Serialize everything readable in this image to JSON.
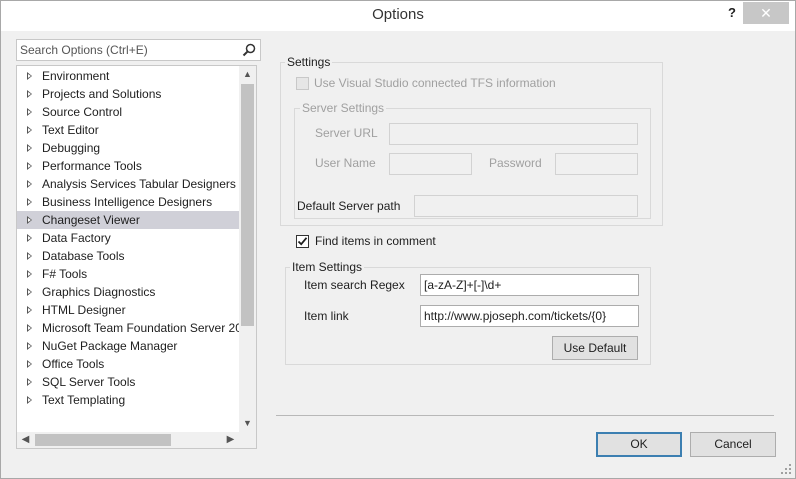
{
  "window": {
    "title": "Options",
    "help_label": "?",
    "close_label": "✕"
  },
  "search": {
    "placeholder": "Search Options (Ctrl+E)"
  },
  "tree": {
    "items": [
      {
        "label": "Environment"
      },
      {
        "label": "Projects and Solutions"
      },
      {
        "label": "Source Control"
      },
      {
        "label": "Text Editor"
      },
      {
        "label": "Debugging"
      },
      {
        "label": "Performance Tools"
      },
      {
        "label": "Analysis Services Tabular Designers"
      },
      {
        "label": "Business Intelligence Designers"
      },
      {
        "label": "Changeset Viewer",
        "selected": true
      },
      {
        "label": "Data Factory"
      },
      {
        "label": "Database Tools"
      },
      {
        "label": "F# Tools"
      },
      {
        "label": "Graphics Diagnostics"
      },
      {
        "label": "HTML Designer"
      },
      {
        "label": "Microsoft Team Foundation Server 20"
      },
      {
        "label": "NuGet Package Manager"
      },
      {
        "label": "Office Tools"
      },
      {
        "label": "SQL Server Tools"
      },
      {
        "label": "Text Templating"
      }
    ]
  },
  "settings": {
    "legend": "Settings",
    "use_tfs_label": "Use Visual Studio connected TFS information",
    "use_tfs_checked": false,
    "server_settings": {
      "legend": "Server Settings",
      "server_url_label": "Server URL",
      "server_url_value": "",
      "user_name_label": "User Name",
      "user_name_value": "",
      "password_label": "Password",
      "password_value": ""
    },
    "default_server_path_label": "Default Server path",
    "default_server_path_value": ""
  },
  "find_items": {
    "label": "Find items in comment",
    "checked": true
  },
  "item_settings": {
    "legend": "Item Settings",
    "regex_label": "Item search Regex",
    "regex_value": "[a-zA-Z]+[-]\\d+",
    "link_label": "Item link",
    "link_value": "http://www.pjoseph.com/tickets/{0}",
    "use_default_label": "Use Default"
  },
  "footer": {
    "ok_label": "OK",
    "cancel_label": "Cancel"
  },
  "colors": {
    "selection": "#d0d0d8",
    "primary_border": "#3c7fb1",
    "close_button": "#c7c7c7"
  }
}
